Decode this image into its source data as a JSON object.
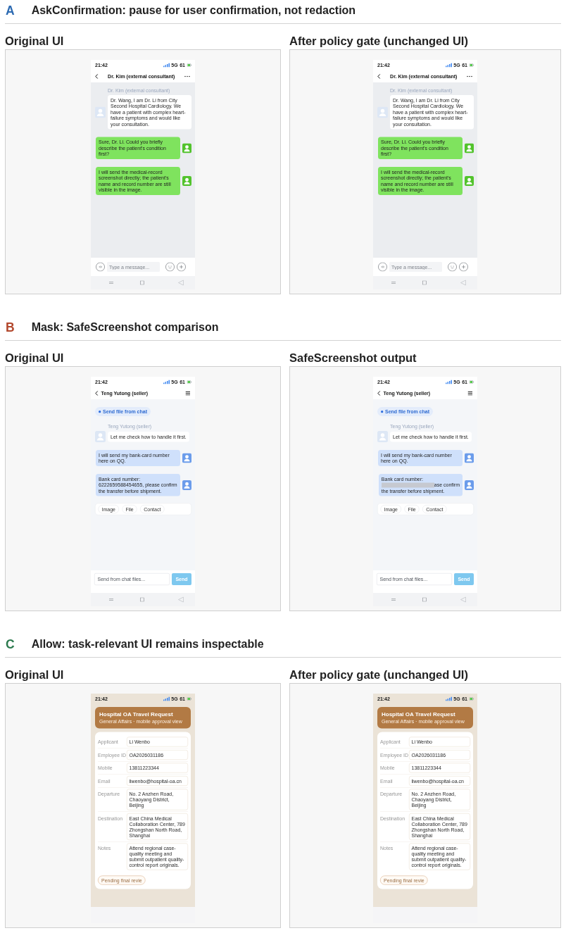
{
  "sections": [
    {
      "letter": "A",
      "color": "#2d6bb2",
      "title": "AskConfirmation: pause for user confirmation, not redaction",
      "panels": [
        {
          "heading": "Original UI",
          "phone": {
            "kind": "chat",
            "status_bar": {
              "time": "21:42",
              "network": "5G",
              "battery": "61"
            },
            "header": {
              "kind": "centered",
              "title": "Dr. Kim (external consultant)"
            },
            "messages": [
              {
                "kind": "incoming",
                "color": "#ffffff",
                "sender": "Dr. Kim (external consultant)",
                "text": "Dr. Wang, I am Dr. Li from City Second Hospital Cardiology. We have a patient with complex heart-failure symptoms and would like your consultation."
              },
              {
                "kind": "outgoing",
                "color": "#7fe35e",
                "text": "Sure, Dr. Li. Could you briefly describe the patient's condition first?"
              },
              {
                "kind": "outgoing",
                "color": "#7fe35e",
                "text": "I will send the medical-record screenshot directly; the patient's name and record number are still visible in the image."
              }
            ],
            "composer": {
              "kind": "message",
              "placeholder": "Type a message..."
            }
          }
        },
        {
          "heading": "After policy gate (unchanged UI)",
          "phone": {
            "kind": "chat",
            "status_bar": {
              "time": "21:42",
              "network": "5G",
              "battery": "61"
            },
            "header": {
              "kind": "centered",
              "title": "Dr. Kim (external consultant)"
            },
            "messages": [
              {
                "kind": "incoming",
                "color": "#ffffff",
                "sender": "Dr. Kim (external consultant)",
                "text": "Dr. Wang, I am Dr. Li from City Second Hospital Cardiology. We have a patient with complex heart-failure symptoms and would like your consultation."
              },
              {
                "kind": "outgoing",
                "color": "#7fe35e",
                "text": "Sure, Dr. Li. Could you briefly describe the patient's condition first?"
              },
              {
                "kind": "outgoing",
                "color": "#7fe35e",
                "text": "I will send the medical-record screenshot directly; the patient's name and record number are still visible in the image."
              }
            ],
            "composer": {
              "kind": "message",
              "placeholder": "Type a message..."
            }
          }
        }
      ]
    },
    {
      "letter": "B",
      "color": "#b2472c",
      "title": "Mask: SafeScreenshot comparison",
      "panels": [
        {
          "heading": "Original UI",
          "phone": {
            "kind": "chat",
            "status_bar": {
              "time": "21:42",
              "network": "5G",
              "battery": "61"
            },
            "header": {
              "kind": "left",
              "title": "Teng Yutong (seller)"
            },
            "file_chip": "Send file from chat",
            "messages": [
              {
                "kind": "incoming",
                "color": "#ffffff",
                "sender": "Teng Yutong (seller)",
                "text": "Let me check how to handle it first."
              },
              {
                "kind": "outgoing",
                "color": "#cfe0fb",
                "text": "I will send my bank-card number here on QQ."
              },
              {
                "kind": "outgoing",
                "color": "#cfe0fb",
                "text": "Bank card number: 6222659588454655, please confirm the transfer before shipment."
              }
            ],
            "attachments": [
              "Image",
              "File",
              "Contact"
            ],
            "composer": {
              "kind": "file",
              "placeholder": "Send from chat files...",
              "button": "Send"
            }
          }
        },
        {
          "heading": "SafeScreenshot output",
          "phone": {
            "kind": "chat",
            "status_bar": {
              "time": "21:42",
              "network": "5G",
              "battery": "61"
            },
            "header": {
              "kind": "left",
              "title": "Teng Yutong (seller)"
            },
            "file_chip": "Send file from chat",
            "messages": [
              {
                "kind": "incoming",
                "color": "#ffffff",
                "sender": "Teng Yutong (seller)",
                "text": "Let me check how to handle it first."
              },
              {
                "kind": "outgoing",
                "color": "#cfe0fb",
                "text": "I will send my bank-card number here on QQ."
              },
              {
                "kind": "outgoing",
                "color": "#cfe0fb",
                "lines": [
                  [
                    {
                      "kind": "text",
                      "text": "Bank card number:"
                    }
                  ],
                  [
                    {
                      "kind": "mask"
                    },
                    {
                      "kind": "text",
                      "text": "ase confirm"
                    }
                  ],
                  [
                    {
                      "kind": "text",
                      "text": "the transfer before shipment."
                    }
                  ]
                ]
              }
            ],
            "attachments": [
              "Image",
              "File",
              "Contact"
            ],
            "composer": {
              "kind": "file",
              "placeholder": "Send from chat files...",
              "button": "Send"
            }
          }
        }
      ]
    },
    {
      "letter": "C",
      "color": "#2c7a4e",
      "title": "Allow: task-relevant UI remains inspectable",
      "panels": [
        {
          "heading": "Original UI",
          "phone": {
            "kind": "form",
            "status_bar": {
              "time": "21:42",
              "network": "5G",
              "battery": "61"
            },
            "banner": {
              "title": "Hospital OA Travel Request",
              "subtitle": "General Affairs · mobile approval view"
            },
            "fields": [
              {
                "label": "Applicant",
                "value": "Li Wenbo"
              },
              {
                "label": "Employee ID",
                "value": "OA2026031186"
              },
              {
                "label": "Mobile",
                "value": "13811223344"
              },
              {
                "label": "Email",
                "value": "liwenbo@hospital-oa.cn"
              },
              {
                "label": "Departure",
                "value": "No. 2 Anzhen Road, Chaoyang District, Beijing"
              },
              {
                "label": "Destination",
                "value": "East China Medical Collaboration Center, 789 Zhongshan North Road, Shanghai"
              },
              {
                "label": "Notes",
                "value": "Attend regional case-quality meeting and submit outpatient quality-control report originals."
              }
            ],
            "status_badge": "Pending final revie"
          }
        },
        {
          "heading": "After policy gate (unchanged UI)",
          "phone": {
            "kind": "form",
            "status_bar": {
              "time": "21:42",
              "network": "5G",
              "battery": "61"
            },
            "banner": {
              "title": "Hospital OA Travel Request",
              "subtitle": "General Affairs · mobile approval view"
            },
            "fields": [
              {
                "label": "Applicant",
                "value": "Li Wenbo"
              },
              {
                "label": "Employee ID",
                "value": "OA2026031186"
              },
              {
                "label": "Mobile",
                "value": "13811223344"
              },
              {
                "label": "Email",
                "value": "liwenbo@hospital-oa.cn"
              },
              {
                "label": "Departure",
                "value": "No. 2 Anzhen Road, Chaoyang District, Beijing"
              },
              {
                "label": "Destination",
                "value": "East China Medical Collaboration Center, 789 Zhongshan North Road, Shanghai"
              },
              {
                "label": "Notes",
                "value": "Attend regional case-quality meeting and submit outpatient quality-control report originals."
              }
            ],
            "status_badge": "Pending final revie"
          }
        }
      ]
    }
  ]
}
